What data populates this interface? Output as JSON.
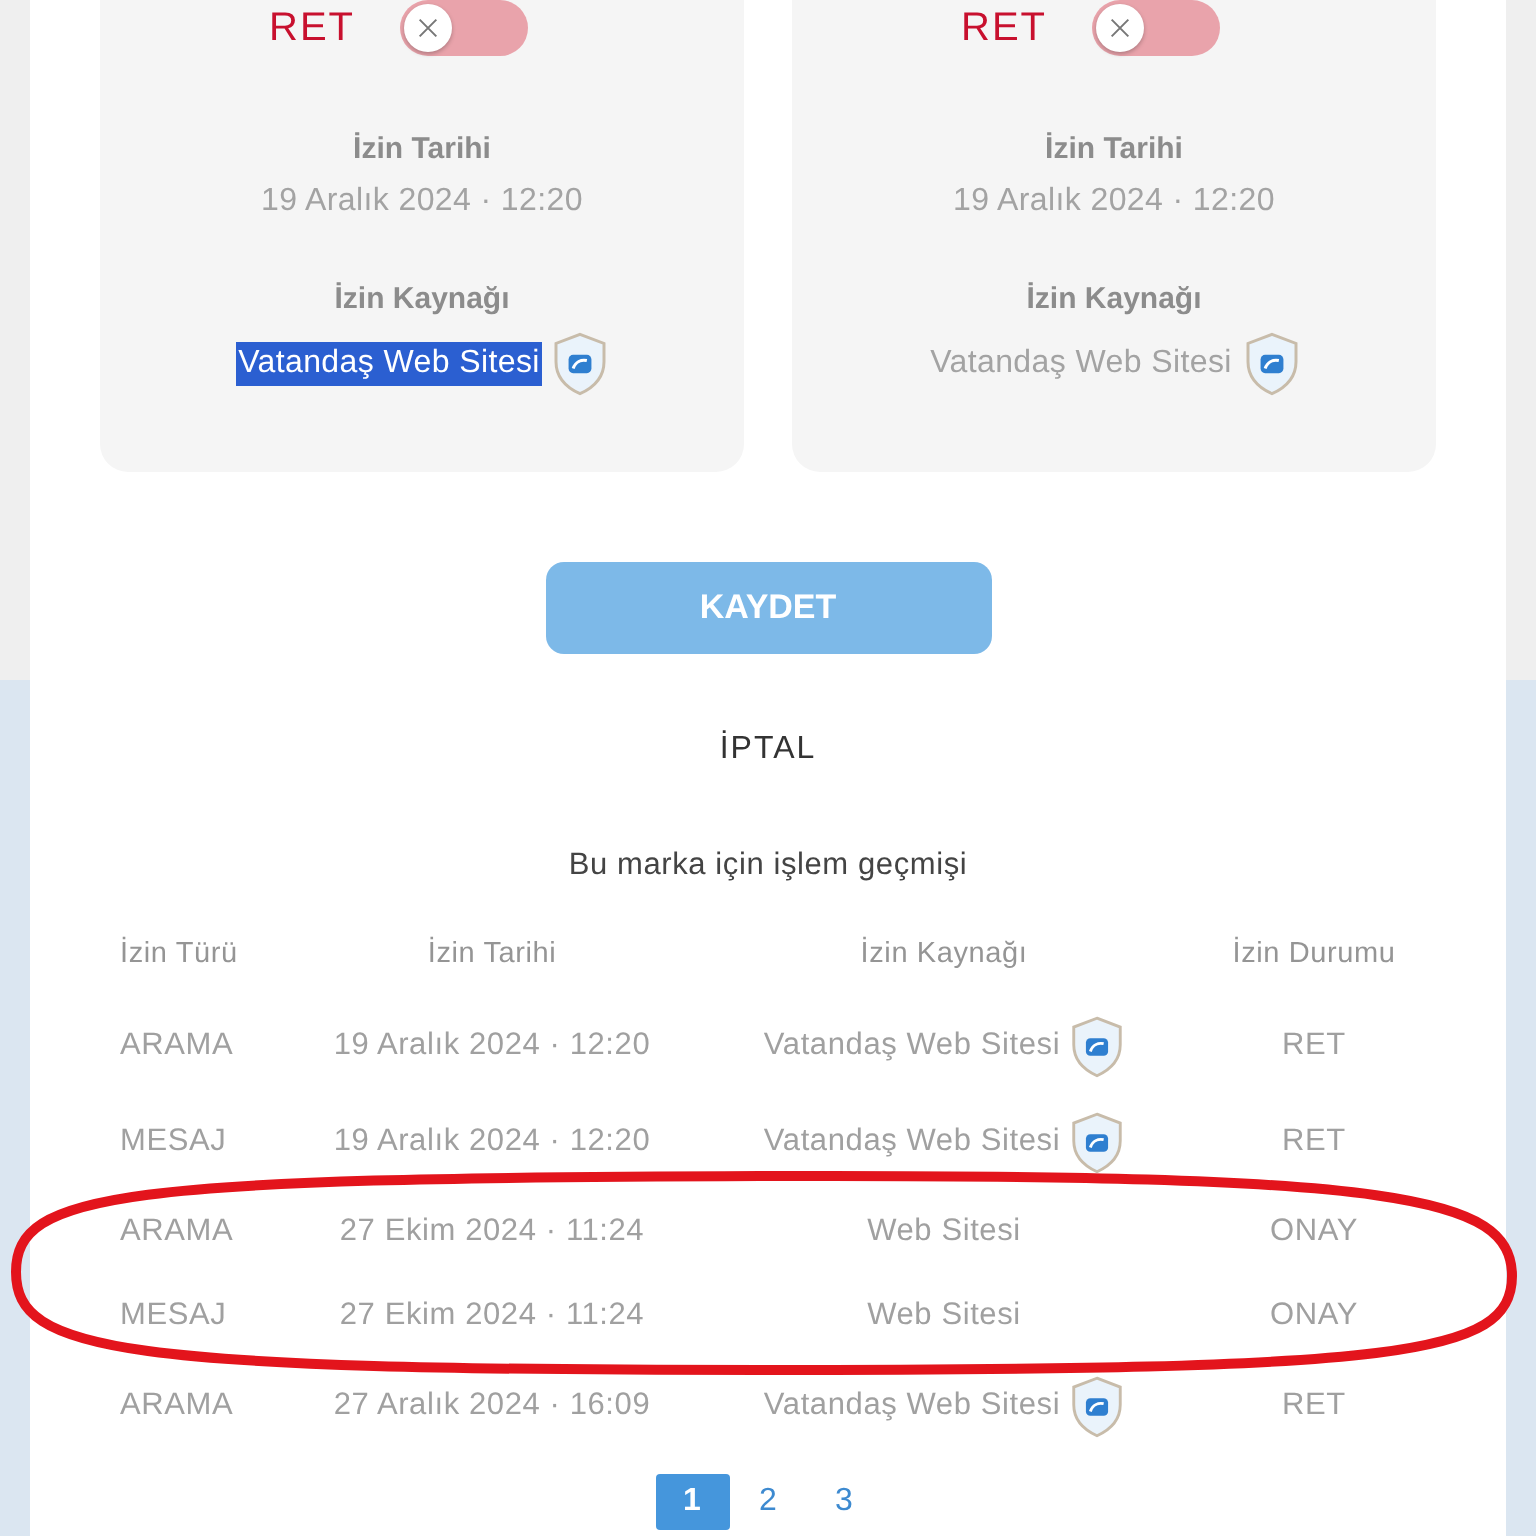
{
  "consent_cards": [
    {
      "status": "RET",
      "toggle": {
        "on": false
      },
      "date_label": "İzin Tarihi",
      "date": "19 Aralık 2024 · 12:20",
      "source_label": "İzin Kaynağı",
      "source": "Vatandaş Web Sitesi",
      "source_highlighted": true,
      "verified": true
    },
    {
      "status": "RET",
      "toggle": {
        "on": false
      },
      "date_label": "İzin Tarihi",
      "date": "19 Aralık 2024 · 12:20",
      "source_label": "İzin Kaynağı",
      "source": "Vatandaş Web Sitesi",
      "source_highlighted": false,
      "verified": true
    }
  ],
  "save_button": {
    "label": "KAYDET",
    "disabled": true
  },
  "cancel_link": "İPTAL",
  "history": {
    "title": "Bu marka için işlem geçmişi",
    "columns": [
      "İzin Türü",
      "İzin Tarihi",
      "İzin Kaynağı",
      "İzin Durumu"
    ],
    "rows": [
      {
        "type": "ARAMA",
        "date": "19 Aralık 2024 · 12:20",
        "source": "Vatandaş Web Sitesi",
        "verified": true,
        "status": "RET"
      },
      {
        "type": "MESAJ",
        "date": "19 Aralık 2024 · 12:20",
        "source": "Vatandaş Web Sitesi",
        "verified": true,
        "status": "RET"
      },
      {
        "type": "ARAMA",
        "date": "27 Ekim 2024 · 11:24",
        "source": "Web Sitesi",
        "verified": false,
        "status": "ONAY"
      },
      {
        "type": "MESAJ",
        "date": "27 Ekim 2024 · 11:24",
        "source": "Web Sitesi",
        "verified": false,
        "status": "ONAY"
      },
      {
        "type": "ARAMA",
        "date": "27 Aralık 2024 · 16:09",
        "source": "Vatandaş Web Sitesi",
        "verified": true,
        "status": "RET"
      }
    ]
  },
  "pagination": [
    {
      "label": "1",
      "selected": true
    },
    {
      "label": "2",
      "selected": false
    },
    {
      "label": "3",
      "selected": false
    }
  ]
}
